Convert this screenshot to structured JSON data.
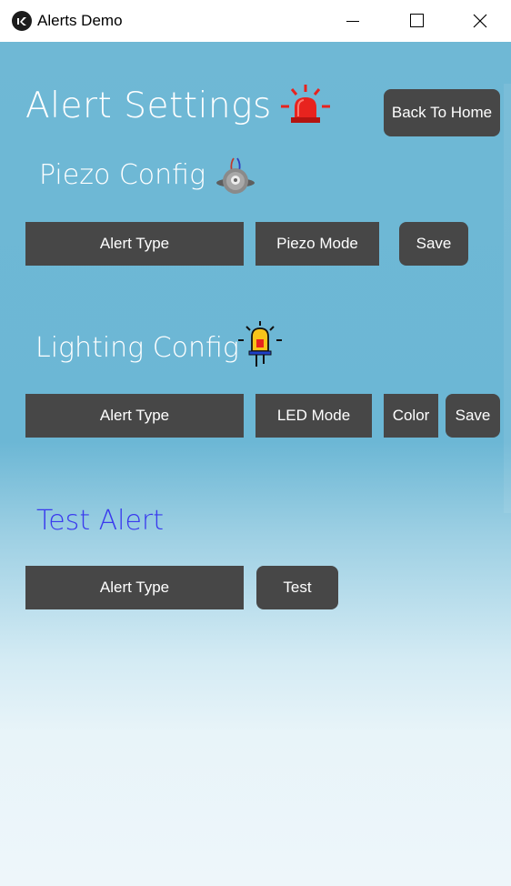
{
  "window": {
    "title": "Alerts Demo",
    "app_icon": "kivy-logo-icon",
    "controls": [
      "minimize-icon",
      "maximize-icon",
      "close-icon"
    ]
  },
  "header": {
    "title": "Alert Settings",
    "icon": "siren-icon",
    "back_button": "Back To Home"
  },
  "piezo": {
    "title": "Piezo Config",
    "icon": "buzzer-icon",
    "alert_type": "Alert Type",
    "mode": "Piezo Mode",
    "save": "Save"
  },
  "lighting": {
    "title": "Lighting Config",
    "icon": "led-bulb-icon",
    "alert_type": "Alert Type",
    "mode": "LED Mode",
    "color": "Color",
    "save": "Save"
  },
  "test": {
    "title": "Test Alert",
    "alert_type": "Alert Type",
    "test": "Test"
  },
  "colors": {
    "background_top": "#6fb8d5",
    "background_bottom": "#eef6fa",
    "button": "#474747",
    "button_text": "#ffffff",
    "test_heading": "#3a3aee",
    "siren_red": "#e8231e"
  }
}
